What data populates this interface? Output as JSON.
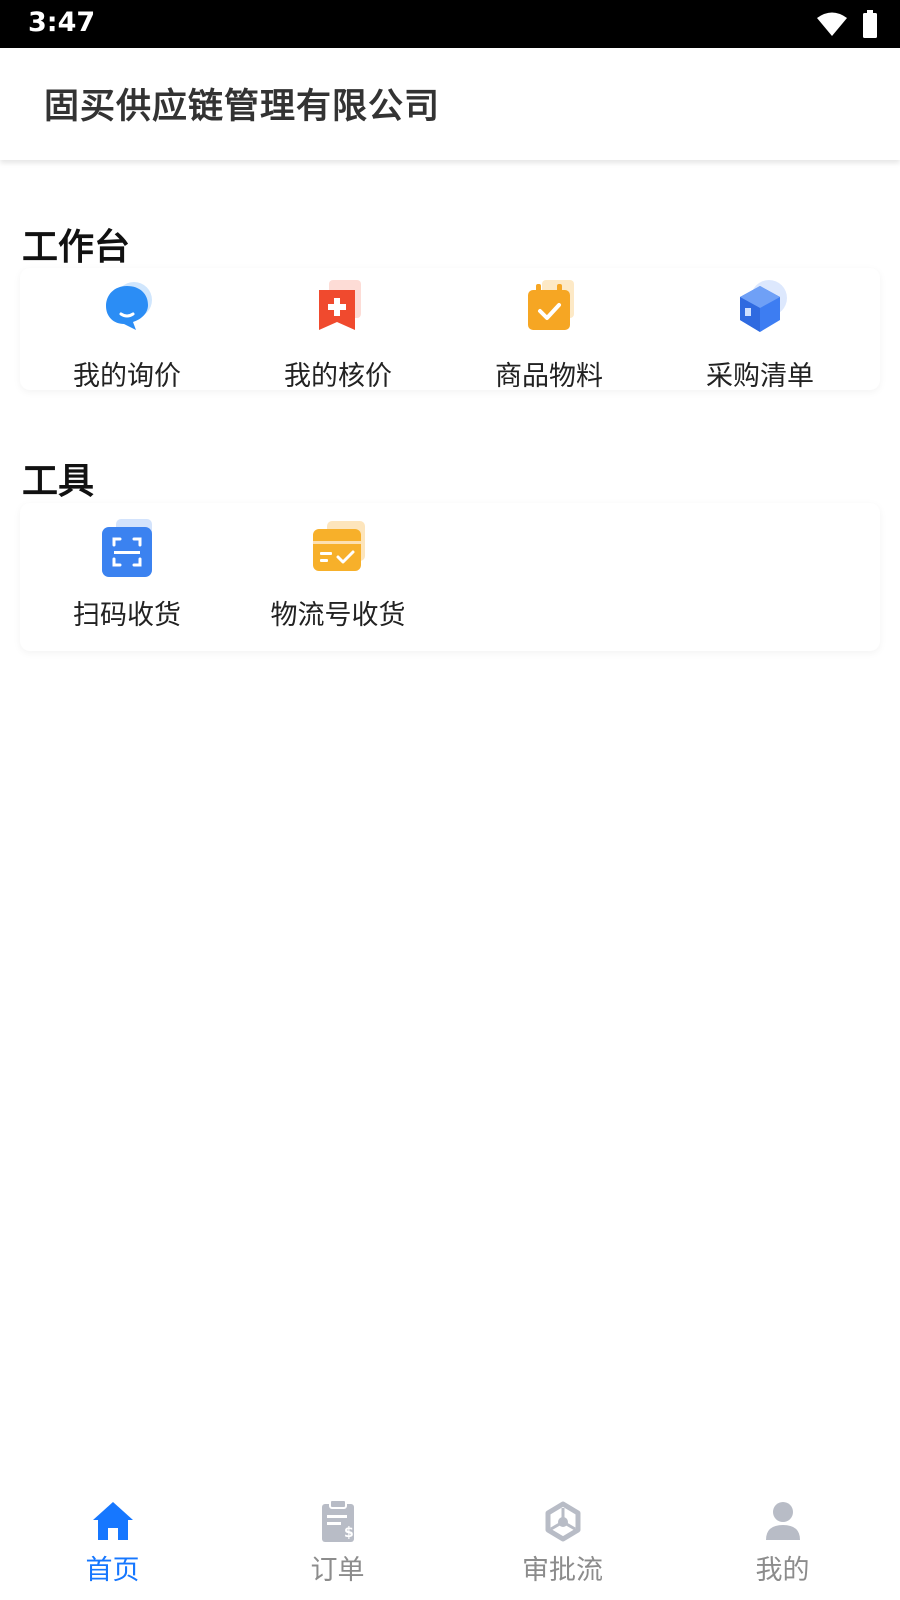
{
  "status_bar": {
    "time": "3:47"
  },
  "header": {
    "title": "固买供应链管理有限公司"
  },
  "workbench": {
    "title": "工作台",
    "items": [
      {
        "label": "我的询价",
        "icon": "chat-bubble-icon",
        "color": "#2b8df5"
      },
      {
        "label": "我的核价",
        "icon": "medical-bookmark-icon",
        "color": "#f04a2e"
      },
      {
        "label": "商品物料",
        "icon": "calendar-check-icon",
        "color": "#f6a623"
      },
      {
        "label": "采购清单",
        "icon": "cube-icon",
        "color": "#3d7df2"
      }
    ]
  },
  "tools": {
    "title": "工具",
    "items": [
      {
        "label": "扫码收货",
        "icon": "scan-icon",
        "color": "#3b82f0"
      },
      {
        "label": "物流号收货",
        "icon": "card-check-icon",
        "color": "#f7b02a"
      }
    ]
  },
  "tab_bar": {
    "active_color": "#1677ff",
    "inactive_color": "#b8bcc6",
    "items": [
      {
        "label": "首页",
        "icon": "home-icon",
        "active": true
      },
      {
        "label": "订单",
        "icon": "order-clipboard-icon",
        "active": false
      },
      {
        "label": "审批流",
        "icon": "approval-flow-icon",
        "active": false
      },
      {
        "label": "我的",
        "icon": "user-icon",
        "active": false
      }
    ]
  }
}
